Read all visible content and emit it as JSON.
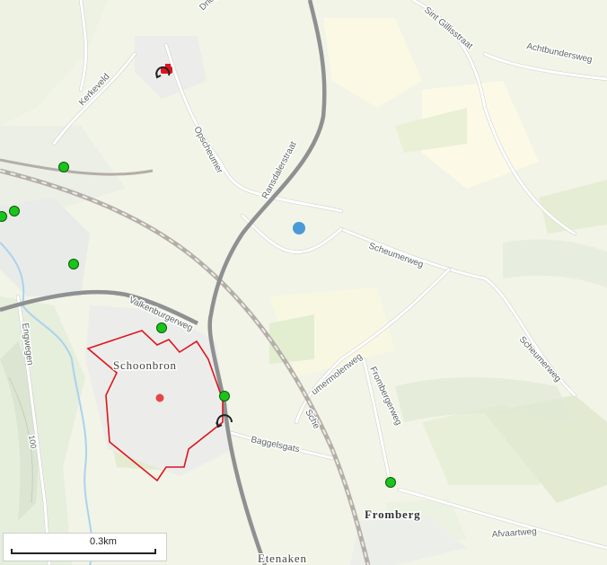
{
  "map": {
    "streets": {
      "drieg": "Drieg",
      "kerkeveld": "Kerkeveld",
      "opscheumer": "Opscheumer",
      "ransdalerstraat": "Ransdalerstraat",
      "sint_gillisstraat": "Sint Gillisstraat",
      "achtbundersweg": "Achtbundersweg",
      "scheumerweg_1": "Scheumerweg",
      "scheumerweg_2": "Scheumerweg",
      "valkenburgerweg": "Valkenburgerweg",
      "engwegen": "Engwegen",
      "umermolenweg": "umermolenweg",
      "frombergerweg": "Frombergerweg",
      "baggelsgats": "Baggelsgats",
      "afvaartweg": "Afvaartweg",
      "schei_rail": "Sche",
      "contour": "100"
    },
    "places": {
      "schoonbron": "Schoonbron",
      "fromberg": "Fromberg",
      "etenaken": "Etenaken"
    },
    "scale": {
      "label": "0.3km"
    },
    "colors": {
      "green_marker": "#1bc41b",
      "red_marker": "#e9434a",
      "blue_marker": "#4a9ad7",
      "boundary": "#e0141e",
      "main_road": "#8f9091",
      "railway": "#b4aea8"
    }
  }
}
